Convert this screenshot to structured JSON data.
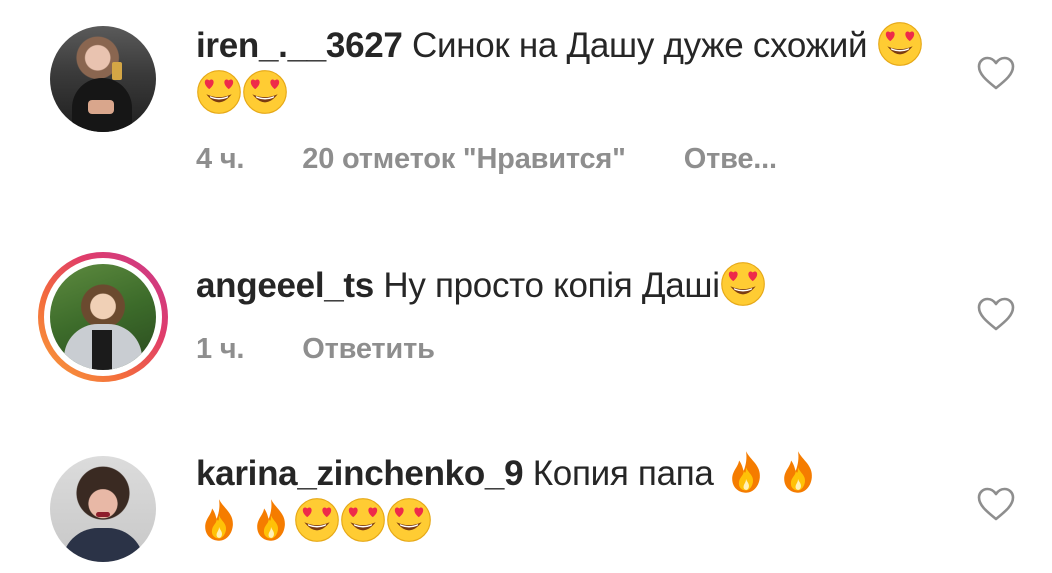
{
  "comments": [
    {
      "username": "iren_.__3627",
      "text": " Синок на Дашу дуже схожий ",
      "emojis": [
        "heart-eyes-emoji",
        "heart-eyes-emoji",
        "heart-eyes-emoji"
      ],
      "time": "4 ч.",
      "likes": "20 отметок \"Нравится\"",
      "reply": "Отве..."
    },
    {
      "username": "angeeel_ts",
      "text": " Ну просто копія Даші",
      "emojis": [
        "heart-eyes-emoji"
      ],
      "time": "1 ч.",
      "reply": "Ответить"
    },
    {
      "username": "karina_zinchenko_9",
      "text": " Копия папа ",
      "emojis": [
        "fire-emoji",
        "fire-emoji",
        "fire-emoji",
        "fire-emoji",
        "heart-eyes-emoji",
        "heart-eyes-emoji",
        "heart-eyes-emoji"
      ]
    }
  ],
  "icons": {
    "like": "heart-outline-icon"
  },
  "colors": {
    "text": "#262626",
    "meta": "#8e8e8e",
    "story_ring_start": "#f9a23a",
    "story_ring_end": "#c7398f"
  }
}
